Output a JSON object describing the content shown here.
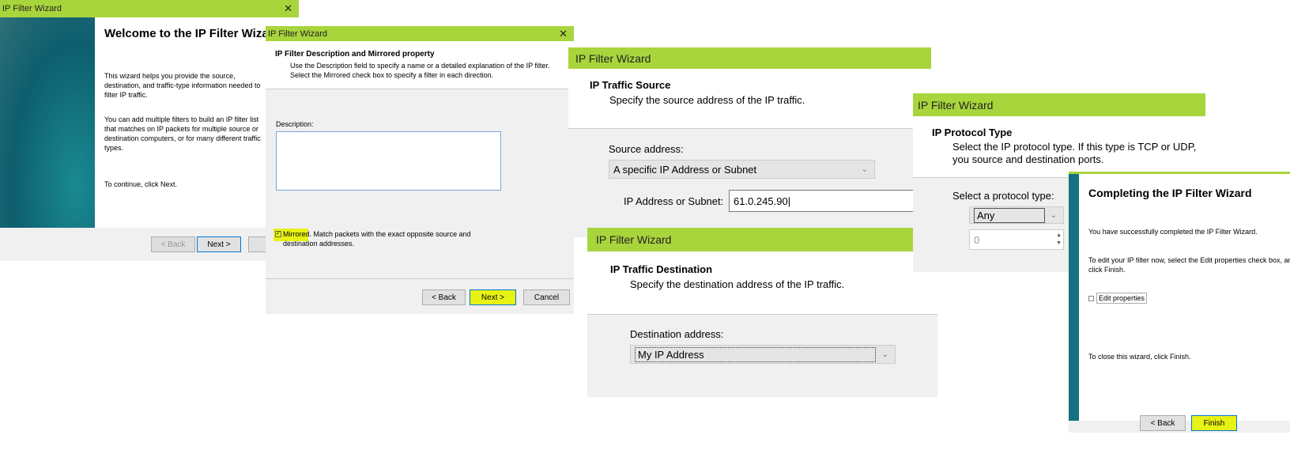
{
  "accent": "#a8d53c",
  "highlight": "#e8f214",
  "welcome": {
    "title_bar": "IP Filter Wizard",
    "close": "✕",
    "heading": "Welcome to the IP Filter Wizard",
    "p1": "This wizard helps you provide the source, destination, and traffic-type information needed to filter IP traffic.",
    "p2": "You can add multiple filters to build an IP filter list that matches on IP packets for multiple source or destination computers, or for many different traffic types.",
    "p3": "To continue, click Next.",
    "back": "< Back",
    "next": "Next >",
    "cancel": "C"
  },
  "description": {
    "title_bar": "IP Filter Wizard",
    "close": "✕",
    "heading": "IP Filter Description and Mirrored property",
    "sub1": "Use the Description field to specify a name or a detailed explanation of the IP filter.",
    "sub2": "Select the Mirrored check box to specify a filter in each direction.",
    "desc_label": "Description:",
    "desc_value": "",
    "mirrored_checked": true,
    "mirrored_label": "Mirrored.",
    "mirrored_text": "Match packets with the exact opposite source and destination addresses.",
    "back": "< Back",
    "next": "Next >",
    "cancel": "Cancel"
  },
  "source": {
    "title_bar": "IP Filter Wizard",
    "heading": "IP Traffic Source",
    "sub": "Specify the source address of the IP traffic.",
    "label": "Source address:",
    "selected": "A specific IP Address or Subnet",
    "ip_label": "IP Address or Subnet:",
    "ip_value": "61.0.245.90"
  },
  "destination": {
    "title_bar": "IP Filter Wizard",
    "heading": "IP Traffic Destination",
    "sub": "Specify the destination address of the IP traffic.",
    "label": "Destination address:",
    "selected": "My IP Address"
  },
  "protocol": {
    "title_bar": "IP Filter Wizard",
    "heading": "IP Protocol Type",
    "sub": "Select the IP protocol type. If this type is TCP or UDP, you source and destination ports.",
    "label": "Select a protocol type:",
    "selected": "Any",
    "port_value": "0"
  },
  "complete": {
    "heading": "Completing the IP Filter Wizard",
    "p1": "You have successfully completed the IP Filter Wizard.",
    "p2": "To edit your IP filter now, select the Edit properties check box, and then click Finish.",
    "edit_label": "Edit properties",
    "edit_checked": false,
    "p3": "To close this wizard, click Finish.",
    "back": "< Back",
    "finish": "Finish"
  }
}
